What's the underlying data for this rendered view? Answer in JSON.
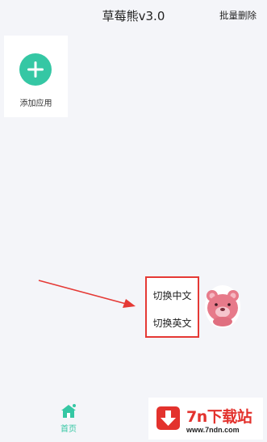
{
  "header": {
    "title": "草莓熊v3.0",
    "batch_delete": "批量删除"
  },
  "apps": {
    "add_label": "添加应用",
    "add_icon": "plus-icon"
  },
  "language_menu": {
    "chinese": "切换中文",
    "english": "切换英文",
    "border_color": "#e53935"
  },
  "floating_button": {
    "icon": "strawberry-bear-avatar"
  },
  "tabbar": {
    "home_label": "首页",
    "home_icon": "home-icon"
  },
  "watermark": {
    "name": "7n下载站",
    "url": "www.7ndn.com"
  },
  "colors": {
    "accent": "#35c7a4",
    "annotation_red": "#e53935",
    "background": "#f4f5f9"
  }
}
